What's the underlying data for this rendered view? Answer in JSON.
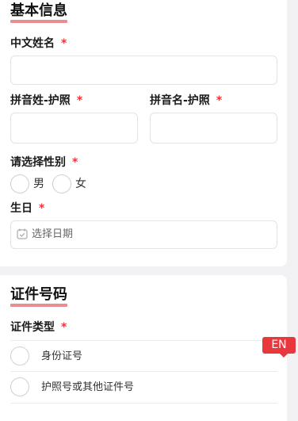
{
  "basic_info": {
    "title": "基本信息",
    "chinese_name": {
      "label": "中文姓名",
      "required_mark": "*",
      "value": ""
    },
    "pinyin_last": {
      "label": "拼音姓-护照",
      "required_mark": "*",
      "value": ""
    },
    "pinyin_first": {
      "label": "拼音名-护照",
      "required_mark": "*",
      "value": ""
    },
    "gender": {
      "label": "请选择性别",
      "required_mark": "*",
      "options": [
        {
          "label": "男"
        },
        {
          "label": "女"
        }
      ]
    },
    "birthday": {
      "label": "生日",
      "required_mark": "*",
      "placeholder": "选择日期",
      "icon": "calendar-icon"
    }
  },
  "certificate": {
    "title": "证件号码",
    "type": {
      "label": "证件类型",
      "required_mark": "*",
      "options": [
        {
          "label": "身份证号"
        },
        {
          "label": "护照号或其他证件号"
        }
      ]
    }
  },
  "language_badge": {
    "label": "EN"
  },
  "colors": {
    "accent": "#e8383d",
    "underline": "#e98d91"
  }
}
